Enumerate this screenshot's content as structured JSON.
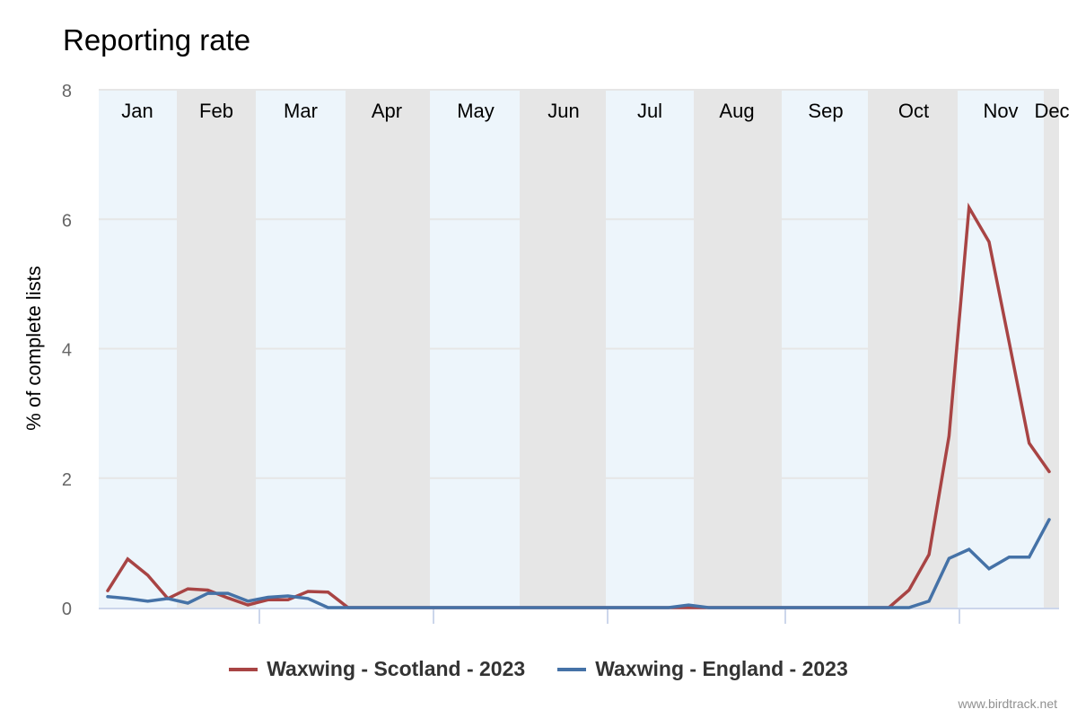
{
  "chart_data": {
    "type": "line",
    "title": "Reporting rate",
    "xlabel": "",
    "ylabel": "% of complete lists",
    "ylim": [
      0,
      8
    ],
    "yticks": [
      "0",
      "2",
      "4",
      "6",
      "8"
    ],
    "ytick_values": [
      0,
      2,
      4,
      6,
      8
    ],
    "grid": true,
    "legend_position": "bottom-center",
    "x_unit": "week of year",
    "x_count": 48,
    "months": [
      {
        "label": "Jan",
        "shade": "light"
      },
      {
        "label": "Feb",
        "shade": "dark"
      },
      {
        "label": "Mar",
        "shade": "light"
      },
      {
        "label": "Apr",
        "shade": "dark"
      },
      {
        "label": "May",
        "shade": "light"
      },
      {
        "label": "Jun",
        "shade": "dark"
      },
      {
        "label": "Jul",
        "shade": "light"
      },
      {
        "label": "Aug",
        "shade": "dark"
      },
      {
        "label": "Sep",
        "shade": "light"
      },
      {
        "label": "Oct",
        "shade": "dark"
      },
      {
        "label": "Nov",
        "shade": "light"
      },
      {
        "label": "Dec",
        "shade": "dark"
      }
    ],
    "series": [
      {
        "name": "Waxwing - Scotland - 2023",
        "color": "#a84444",
        "values": [
          0.26,
          0.75,
          0.5,
          0.14,
          0.29,
          0.27,
          0.15,
          0.04,
          0.12,
          0.12,
          0.25,
          0.24,
          0,
          0,
          0,
          0,
          0,
          0,
          0,
          0,
          0,
          0,
          0,
          0,
          0,
          0,
          0,
          0,
          0,
          0,
          0,
          0,
          0,
          0,
          0,
          0,
          0,
          0,
          0,
          0,
          0.27,
          0.82,
          2.65,
          6.18,
          5.65,
          4.1,
          2.54,
          2.1
        ]
      },
      {
        "name": "Waxwing - England - 2023",
        "color": "#4572a7",
        "values": [
          0.17,
          0.14,
          0.1,
          0.14,
          0.07,
          0.22,
          0.22,
          0.1,
          0.16,
          0.18,
          0.14,
          0,
          0,
          0,
          0,
          0,
          0,
          0,
          0,
          0,
          0,
          0,
          0,
          0,
          0,
          0,
          0,
          0,
          0,
          0.04,
          0,
          0,
          0,
          0,
          0,
          0,
          0,
          0,
          0,
          0,
          0,
          0.1,
          0.76,
          0.9,
          0.6,
          0.78,
          0.78,
          1.36
        ]
      }
    ]
  },
  "colors": {
    "band_light": "#edf5fb",
    "band_dark": "#e6e6e6",
    "grid": "#e6e6e6",
    "axis": "#ccd6eb"
  },
  "credit": "www.birdtrack.net"
}
